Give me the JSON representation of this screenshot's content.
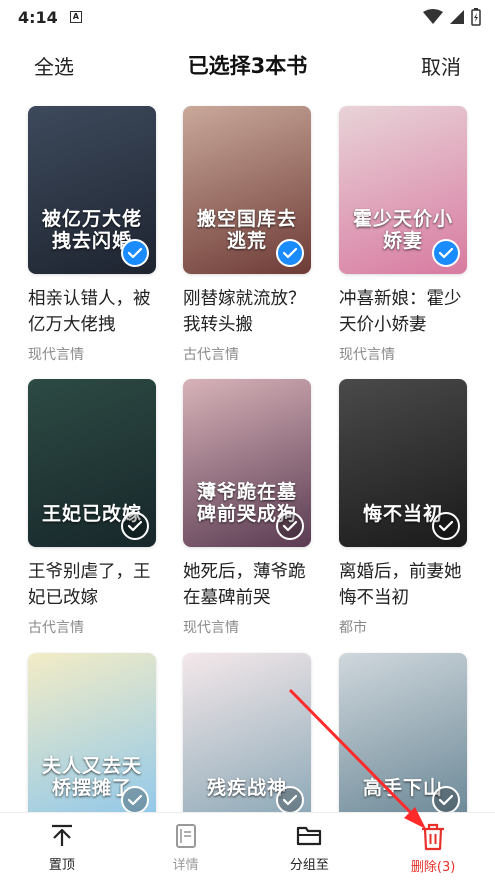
{
  "status_bar": {
    "time": "4:14",
    "a_icon": "A"
  },
  "header": {
    "select_all": "全选",
    "title": "已选择3本书",
    "cancel": "取消"
  },
  "books": [
    {
      "cover_text": "被亿万大佬拽去闪婚",
      "title": "相亲认错人，被亿万大佬拽",
      "category": "现代言情",
      "selected": true,
      "cover_colors": [
        "#3d4a5c",
        "#1e2430"
      ]
    },
    {
      "cover_text": "搬空国库去逃荒",
      "title": "刚替嫁就流放？我转头搬",
      "category": "古代言情",
      "selected": true,
      "cover_colors": [
        "#c9a89a",
        "#6e3b36"
      ]
    },
    {
      "cover_text": "霍少天价小娇妻",
      "title": "冲喜新娘：霍少天价小娇妻",
      "category": "现代言情",
      "selected": true,
      "cover_colors": [
        "#e8d3d8",
        "#d87aa0"
      ]
    },
    {
      "cover_text": "王妃已改嫁",
      "title": "王爷别虐了，王妃已改嫁",
      "category": "古代言情",
      "selected": false,
      "cover_colors": [
        "#2d4a44",
        "#17272a"
      ]
    },
    {
      "cover_text": "薄爷跪在墓碑前哭成狗",
      "title": "她死后，薄爷跪在墓碑前哭",
      "category": "现代言情",
      "selected": false,
      "cover_colors": [
        "#d7b2b8",
        "#5a3b52"
      ]
    },
    {
      "cover_text": "悔不当初",
      "title": "离婚后，前妻她悔不当初",
      "category": "都市",
      "selected": false,
      "cover_colors": [
        "#4a4a4a",
        "#1a1a1a"
      ]
    },
    {
      "cover_text": "夫人又去天桥摆摊了",
      "title": "",
      "category": "",
      "selected": false,
      "cover_colors": [
        "#f3ecc6",
        "#8fc7ea"
      ]
    },
    {
      "cover_text": "残疾战神",
      "title": "",
      "category": "",
      "selected": false,
      "cover_colors": [
        "#f4e8ea",
        "#8aa7b6"
      ]
    },
    {
      "cover_text": "高手下山",
      "title": "",
      "category": "",
      "selected": false,
      "cover_colors": [
        "#cfd7dc",
        "#6a8796"
      ]
    }
  ],
  "bottom_bar": {
    "pin": {
      "label": "置顶",
      "icon": "upload-top-icon"
    },
    "details": {
      "label": "详情",
      "icon": "document-icon"
    },
    "group": {
      "label": "分组至",
      "icon": "folder-icon"
    },
    "delete": {
      "label": "删除(3)",
      "icon": "trash-icon"
    }
  },
  "colors": {
    "accent": "#1a8cff",
    "danger": "#e8302a",
    "annotation_arrow": "#ff2a2a"
  }
}
